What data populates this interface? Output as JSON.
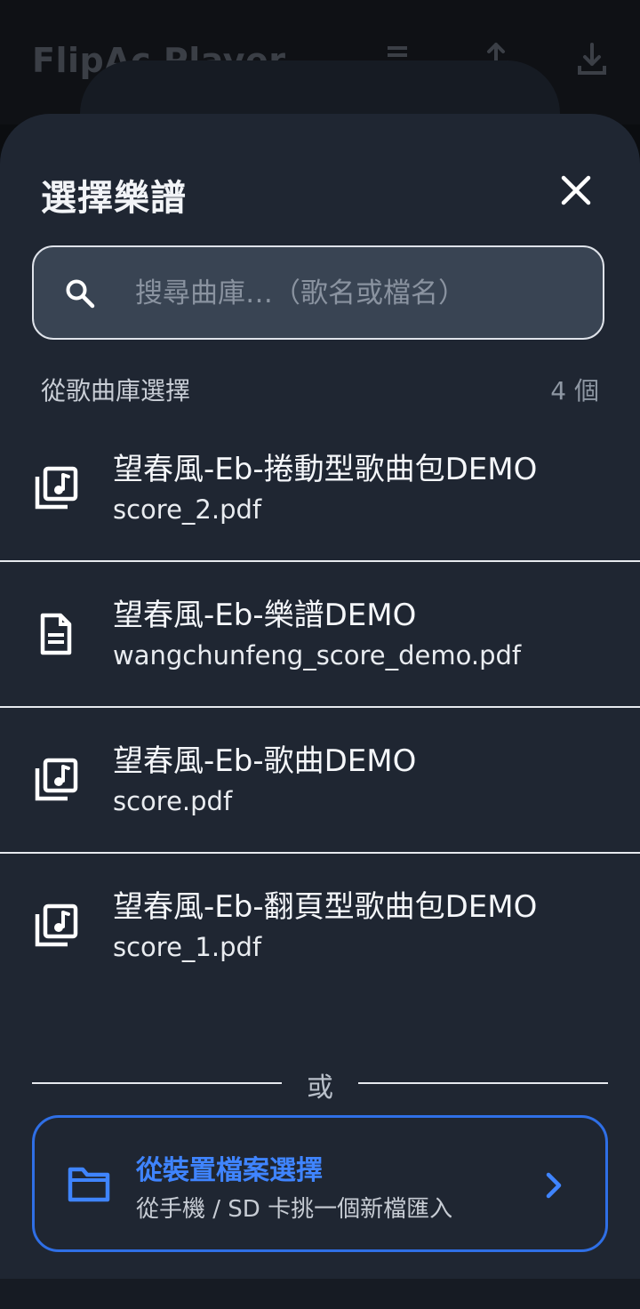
{
  "app": {
    "title": "FlipAc Player",
    "toolbar_icons": [
      "playlist-icon",
      "share-icon",
      "download-icon"
    ]
  },
  "sheet": {
    "title": "選擇樂譜",
    "close_icon": "close-icon"
  },
  "search": {
    "placeholder": "搜尋曲庫…（歌名或檔名）",
    "value": ""
  },
  "library": {
    "label": "從歌曲庫選擇",
    "count": "4 個",
    "items": [
      {
        "title": "望春風-Eb-捲動型歌曲包DEMO",
        "filename": "score_2.pdf",
        "icon": "music-library-icon"
      },
      {
        "title": "望春風-Eb-樂譜DEMO",
        "filename": "wangchunfeng_score_demo.pdf",
        "icon": "document-icon"
      },
      {
        "title": "望春風-Eb-歌曲DEMO",
        "filename": "score.pdf",
        "icon": "music-library-icon"
      },
      {
        "title": "望春風-Eb-翻頁型歌曲包DEMO",
        "filename": "score_1.pdf",
        "icon": "music-library-icon"
      }
    ]
  },
  "separator": {
    "text": "或"
  },
  "device_picker": {
    "title": "從裝置檔案選擇",
    "subtitle": "從手機 / SD 卡挑一個新檔匯入",
    "icon": "folder-icon"
  },
  "colors": {
    "sheet_bg": "#1f2632",
    "accent_blue": "#3f84ff",
    "search_bg": "#394453"
  }
}
